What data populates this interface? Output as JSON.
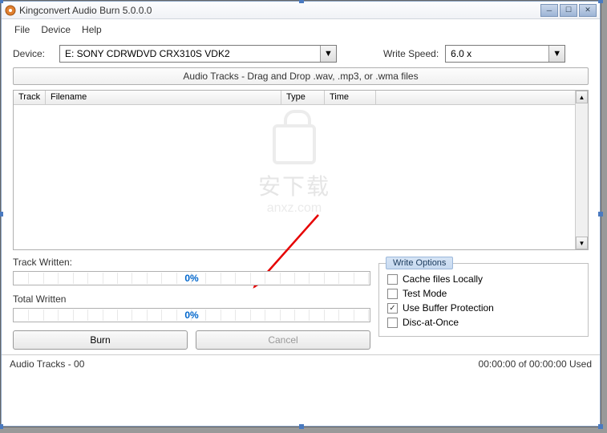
{
  "title": "Kingconvert Audio Burn 5.0.0.0",
  "menu": {
    "file": "File",
    "device": "Device",
    "help": "Help"
  },
  "device": {
    "label": "Device:",
    "value": "E: SONY CDRWDVD CRX310S VDK2"
  },
  "writeSpeed": {
    "label": "Write Speed:",
    "value": "6.0 x"
  },
  "dragBar": "Audio Tracks - Drag and Drop .wav, .mp3, or .wma files",
  "tableHeaders": {
    "track": "Track",
    "filename": "Filename",
    "type": "Type",
    "time": "Time"
  },
  "trackWritten": {
    "label": "Track Written:",
    "percent": "0%"
  },
  "totalWritten": {
    "label": "Total Written",
    "percent": "0%"
  },
  "buttons": {
    "burn": "Burn",
    "cancel": "Cancel"
  },
  "writeOptions": {
    "legend": "Write Options",
    "cache": {
      "label": "Cache files Locally",
      "checked": false
    },
    "test": {
      "label": "Test Mode",
      "checked": false
    },
    "buffer": {
      "label": "Use Buffer Protection",
      "checked": true
    },
    "dao": {
      "label": "Disc-at-Once",
      "checked": false
    }
  },
  "status": {
    "tracks": "Audio Tracks - 00",
    "time": "00:00:00 of 00:00:00 Used"
  },
  "watermark": {
    "t1": "安下载",
    "t2": "anxz.com"
  }
}
